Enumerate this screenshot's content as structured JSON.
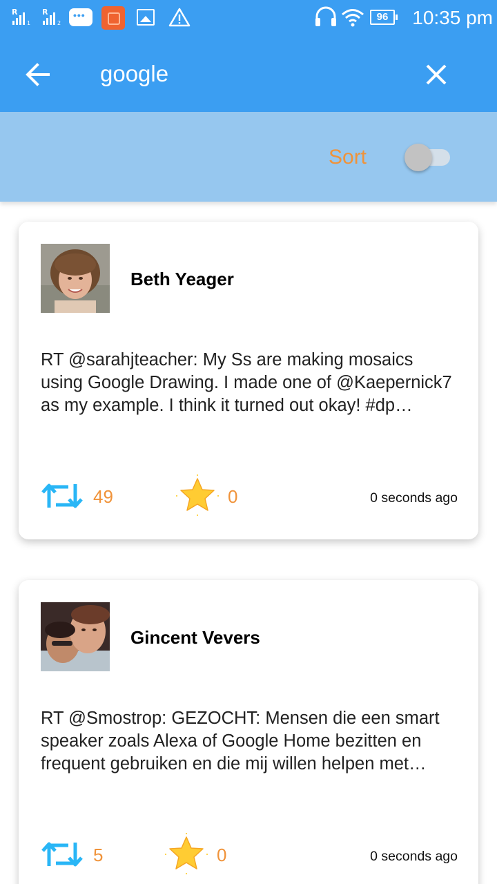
{
  "status_bar": {
    "battery": "96",
    "time": "10:35 pm"
  },
  "search": {
    "query": "google"
  },
  "sort": {
    "label": "Sort",
    "enabled": false
  },
  "colors": {
    "primary": "#3b9ef2",
    "sort_bar": "#96c7ef",
    "accent_orange": "#f0933a",
    "retweet_blue": "#29b6f6"
  },
  "tweets": [
    {
      "author": "Beth Yeager",
      "text": "RT @sarahjteacher: My Ss are making mosaics using Google Drawing. I made one of @Kaepernick7 as my example. I think it turned out okay! #dp…",
      "retweets": "49",
      "favorites": "0",
      "time": "0 seconds ago"
    },
    {
      "author": "Gincent Vevers",
      "text": "RT @Smostrop: GEZOCHT: Mensen die een smart speaker zoals Alexa of Google Home bezitten en frequent gebruiken en die mij willen helpen met…",
      "retweets": "5",
      "favorites": "0",
      "time": "0 seconds ago"
    }
  ]
}
